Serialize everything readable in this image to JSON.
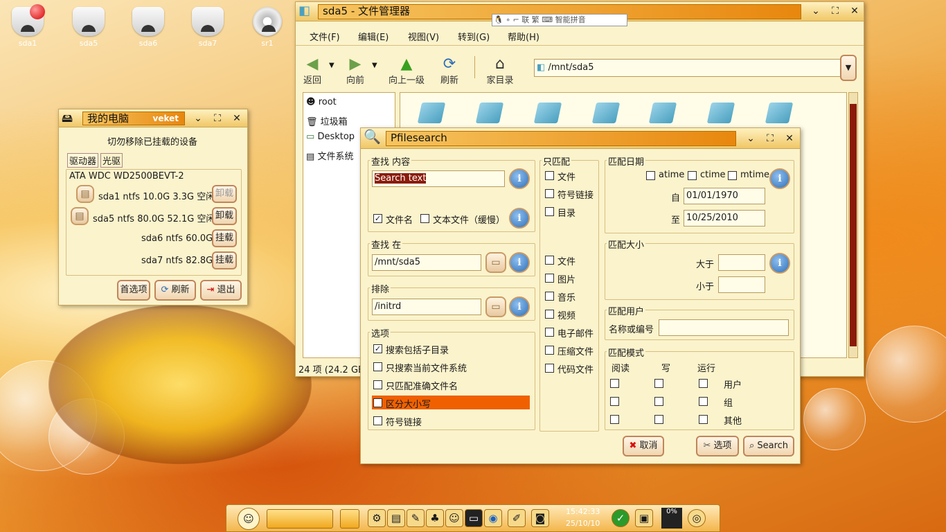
{
  "desktop": {
    "icons": [
      {
        "label": "sda1",
        "icon": "drive-mounted-icon"
      },
      {
        "label": "sda5",
        "icon": "drive-icon"
      },
      {
        "label": "sda6",
        "icon": "drive-icon"
      },
      {
        "label": "sda7",
        "icon": "drive-icon"
      },
      {
        "label": "sr1",
        "icon": "optical-drive-icon"
      }
    ]
  },
  "mypc": {
    "title": "我的电脑",
    "badge": "veket",
    "notice": "切勿移除已挂载的设备",
    "tabs": [
      "驱动器",
      "光驱"
    ],
    "disk_label": "ATA WDC WD2500BEVT-2",
    "partitions": [
      {
        "info": "sda1 ntfs 10.0G 3.3G 空闲",
        "action": "卸载",
        "action_disabled": true
      },
      {
        "info": "sda5 ntfs 80.0G 52.1G 空闲",
        "action": "卸载",
        "action_disabled": false
      },
      {
        "info": "sda6 ntfs 60.0G",
        "action": "挂载",
        "action_disabled": false
      },
      {
        "info": "sda7 ntfs 82.8G",
        "action": "挂载",
        "action_disabled": false
      }
    ],
    "buttons": {
      "prefs": "首选项",
      "refresh": "刷新",
      "quit": "退出"
    }
  },
  "fm": {
    "title": "sda5 - 文件管理器",
    "menu": [
      "文件(F)",
      "编辑(E)",
      "视图(V)",
      "转到(G)",
      "帮助(H)"
    ],
    "toolbar": {
      "back": "返回",
      "forward": "向前",
      "up": "向上一级",
      "refresh": "刷新",
      "home": "家目录"
    },
    "location": "/mnt/sda5",
    "side": [
      "root",
      "垃圾箱",
      "Desktop",
      "文件系统"
    ],
    "status": "24 项 (24.2 GB"
  },
  "ime": {
    "label": "智能拼音"
  },
  "search": {
    "title": "Pfilesearch",
    "content": {
      "group": "查找 内容",
      "text": "Search text",
      "filename": "文件名",
      "filetext": "文本文件（缓慢）"
    },
    "in": {
      "group": "查找 在",
      "path": "/mnt/sda5"
    },
    "exclude": {
      "group": "排除",
      "path": "/initrd"
    },
    "options": {
      "group": "选项",
      "items": [
        "搜索包括子目录",
        "只搜索当前文件系统",
        "只匹配准确文件名",
        "区分大小写",
        "符号链接"
      ],
      "checked": [
        true,
        false,
        false,
        false,
        false
      ],
      "highlight_index": 3
    },
    "only": {
      "group": "只匹配",
      "types1": [
        "文件",
        "符号链接",
        "目录"
      ],
      "types2": [
        "文件",
        "图片",
        "音乐",
        "视频",
        "电子邮件",
        "压缩文件",
        "代码文件"
      ]
    },
    "date": {
      "group": "匹配日期",
      "atime": "atime",
      "ctime": "ctime",
      "mtime": "mtime",
      "from_label": "自",
      "from": "01/01/1970",
      "to_label": "至",
      "to": "10/25/2010"
    },
    "size": {
      "group": "匹配大小",
      "greater": "大于",
      "less": "小于"
    },
    "user": {
      "group": "匹配用户",
      "label": "名称或编号"
    },
    "mode": {
      "group": "匹配模式",
      "cols": [
        "阅读",
        "写",
        "运行"
      ],
      "rows": [
        "用户",
        "组",
        "其他"
      ]
    },
    "buttons": {
      "cancel": "取消",
      "options": "选项",
      "search": "Search"
    }
  },
  "taskbar": {
    "time": "15:42:33",
    "date": "25/10/10",
    "cpu": "0%"
  }
}
